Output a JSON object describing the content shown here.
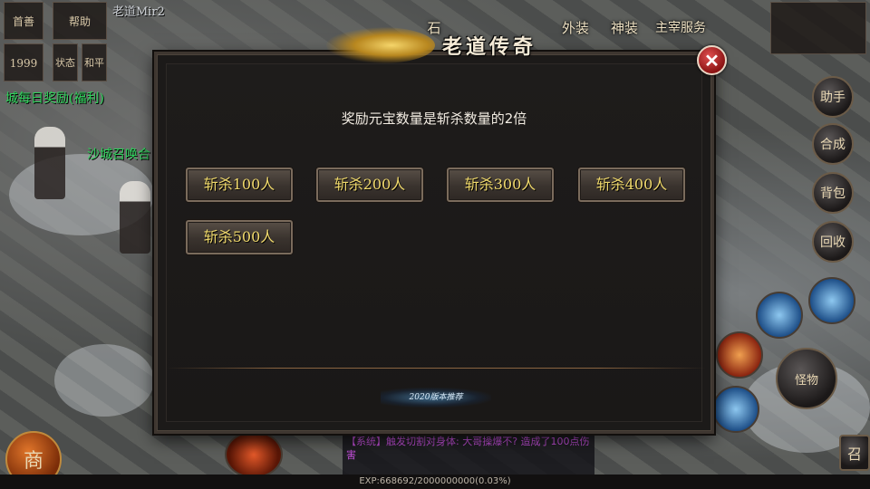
{
  "dialog": {
    "title": "老道传奇",
    "notice": "奖励元宝数量是斩杀数量的2倍",
    "buttons": [
      "斩杀100人",
      "斩杀200人",
      "斩杀300人",
      "斩杀400人",
      "斩杀500人"
    ],
    "close_label": "✕",
    "signature": "2020版本推荐"
  },
  "hud": {
    "top_left": [
      "首善",
      "帮助",
      "1999",
      "状态",
      "和平"
    ],
    "player_name": "老道Mir2",
    "green_lines": [
      "城每日奖励(福利)",
      "沙城召唤合"
    ],
    "top_icons": [
      "石",
      "外装",
      "神装",
      "主宰服务"
    ],
    "right_buttons": [
      "助手",
      "合成",
      "背包",
      "回收",
      "怪物",
      "召"
    ],
    "shop_label": "商",
    "chat": "【系统】触发切割对身体: 大哥操爆不? 造成了100点伤害",
    "exp": "EXP:668692/2000000000(0.03%)"
  },
  "colors": {
    "button_text": "#f0d96c",
    "close": "#b22222",
    "chat_system": "#c24fd8"
  }
}
